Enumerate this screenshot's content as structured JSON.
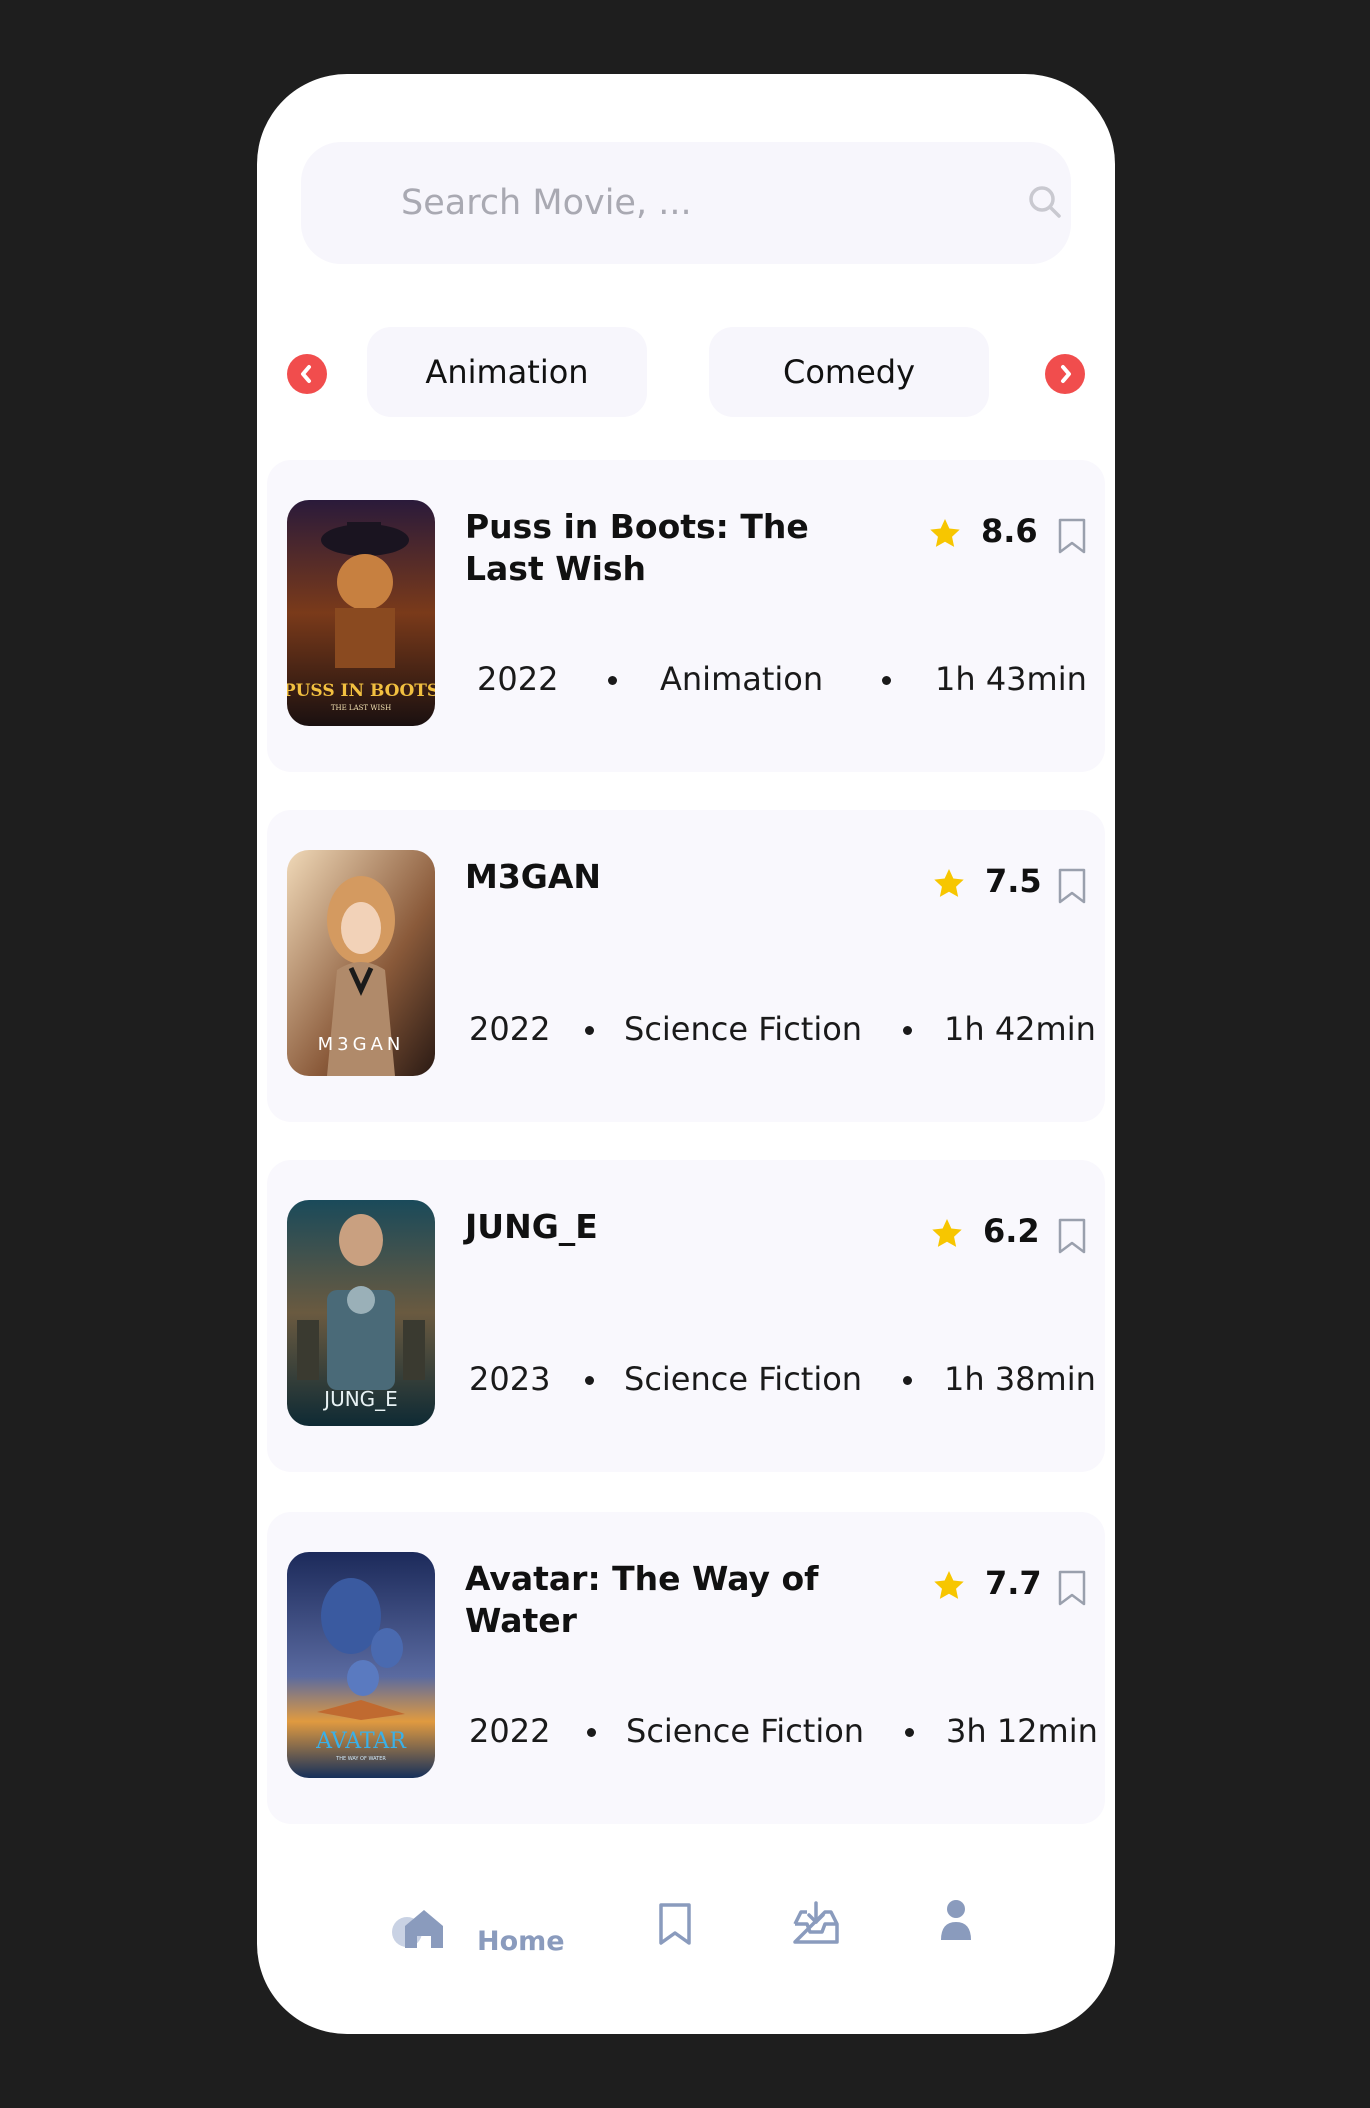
{
  "search": {
    "placeholder": "Search Movie, ..."
  },
  "genres": [
    "Animation",
    "Comedy"
  ],
  "movies": [
    {
      "title": "Puss in Boots: The Last Wish",
      "rating": "8.6",
      "year": "2022",
      "genre": "Animation",
      "duration": "1h 43min",
      "poster_text": "PUSS IN BOOTS",
      "poster_sub": "THE LAST WISH"
    },
    {
      "title": "M3GAN",
      "rating": "7.5",
      "year": "2022",
      "genre": "Science Fiction",
      "duration": "1h 42min",
      "poster_text": "M3GAN"
    },
    {
      "title": "JUNG_E",
      "rating": "6.2",
      "year": "2023",
      "genre": "Science Fiction",
      "duration": "1h 38min",
      "poster_text": "JUNG_E"
    },
    {
      "title": "Avatar: The Way of Water",
      "rating": "7.7",
      "year": "2022",
      "genre": "Science Fiction",
      "duration": "3h 12min",
      "poster_text": "AVATAR",
      "poster_sub": "THE WAY OF WATER"
    }
  ],
  "nav": {
    "home_label": "Home"
  },
  "colors": {
    "accent": "#f14d4d",
    "star": "#f7c600",
    "nav": "#8a9bbd",
    "card_bg": "#f9f8fd"
  },
  "icons": {
    "search": "search-icon",
    "prev": "chevron-left-icon",
    "next": "chevron-right-icon",
    "rating": "star-icon",
    "save": "bookmark-icon",
    "home": "home-icon",
    "saved": "bookmark-icon",
    "downloads": "download-icon",
    "profile": "profile-icon"
  }
}
